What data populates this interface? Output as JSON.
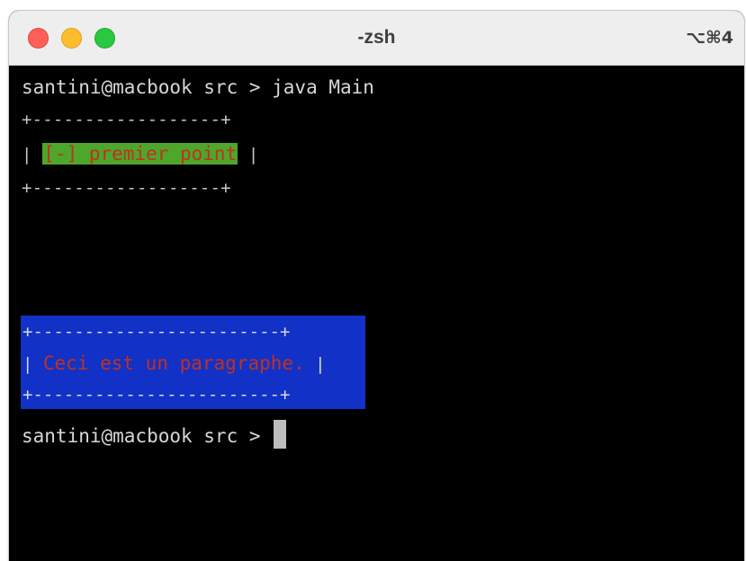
{
  "window": {
    "title": "-zsh",
    "shortcut": "⌥⌘4"
  },
  "terminal": {
    "command_line": "santini@macbook src > java Main",
    "list_box": {
      "top_border": "+------------------+",
      "left_edge": "| ",
      "item_text": "[-] premier point",
      "right_edge": " |",
      "bottom_border": "+------------------+"
    },
    "paragraph_box": {
      "top_border": "+------------------------+",
      "left_edge": "| ",
      "text": "Ceci est un paragraphe.",
      "right_edge": " |",
      "bottom_border": "+------------------------+"
    },
    "prompt": "santini@macbook src > "
  },
  "colors": {
    "background": "#000000",
    "highlight_green": "#4ea62c",
    "highlight_blue": "#1131c7",
    "text_red": "#c1311f",
    "text_default": "#d7d7d7"
  }
}
